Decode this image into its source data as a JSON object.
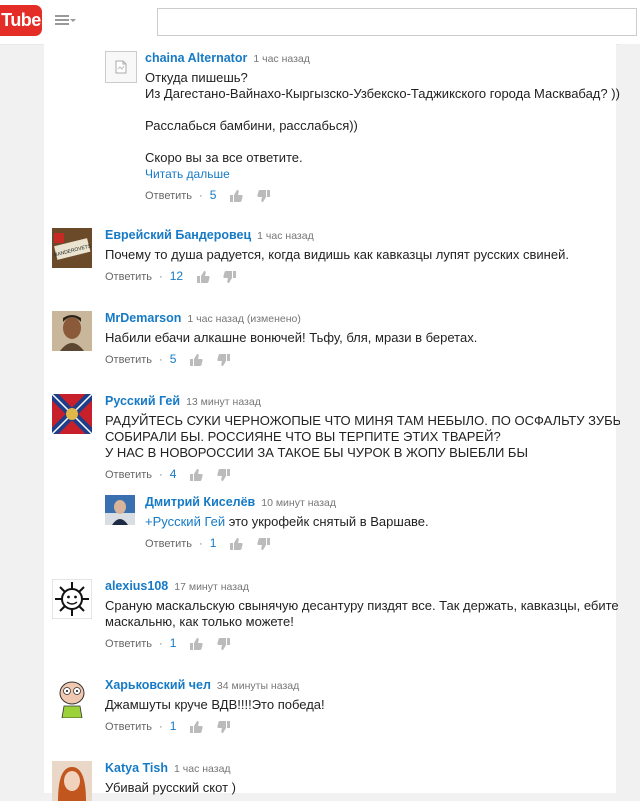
{
  "header": {
    "logo": "Tube",
    "search_placeholder": ""
  },
  "comments": [
    {
      "author": "chaina Alternator",
      "time": "1 час назад",
      "lines": [
        "Откуда пишешь?",
        "Из Дагестано-Вайнахо-Кыргызско-Узбекско-Таджикского города Масквабад? )))",
        "",
        "Расслабься бамбини, расслабься))",
        "",
        "Скоро вы за все ответите."
      ],
      "read_more": "Читать дальше",
      "reply": "Ответить",
      "sep": "·",
      "likes": "5"
    },
    {
      "author": "Еврейский Бандеровец",
      "time": "1 час назад",
      "lines": [
        "Почему то душа радуется, когда видишь как кавказцы лупят русских свиней."
      ],
      "reply": "Ответить",
      "sep": "·",
      "likes": "12",
      "avatar_text": "BANDEROVETS"
    },
    {
      "author": "MrDemarson",
      "time": "1 час назад (изменено)",
      "lines": [
        "Набили ебачи алкашне вонючей! Тьфу, бля, мрази в беретах."
      ],
      "reply": "Ответить",
      "sep": "·",
      "likes": "5"
    },
    {
      "author": "Русский Гей",
      "time": "13 минут назад",
      "lines": [
        "РАДУЙТЕСЬ СУКИ ЧЕРНОЖОПЫЕ ЧТО МИНЯ ТАМ НЕБЫЛО. ПО ОСФАЛЬТУ ЗУБЫ СВОИ",
        "СОБИРАЛИ БЫ. РОССИЯНЕ ЧТО ВЫ ТЕРПИТЕ ЭТИХ ТВАРЕЙ?",
        "У НАС В НОВОРОССИИ ЗА ТАКОЕ БЫ ЧУРОК В ЖОПУ ВЫЕБЛИ БЫ"
      ],
      "reply": "Ответить",
      "sep": "·",
      "likes": "4"
    },
    {
      "author": "Дмитрий Киселёв",
      "time": "10 минут назад",
      "mention": "+Русский Гей",
      "text_after": " это укрофейк снятый в Варшаве.",
      "reply": "Ответить",
      "sep": "·",
      "likes": "1"
    },
    {
      "author": "alexius108",
      "time": "17 минут назад",
      "lines": [
        "Сраную маскальскую свынячую десантуру пиздят все. Так держать, кавказцы, ебите",
        "маскальню, как только можете!"
      ],
      "reply": "Ответить",
      "sep": "·",
      "likes": "1"
    },
    {
      "author": "Харьковский чел",
      "time": "34 минуты назад",
      "lines": [
        "Джамшуты круче ВДВ!!!!Это победа!"
      ],
      "reply": "Ответить",
      "sep": "·",
      "likes": "1"
    },
    {
      "author": "Katya Tish",
      "time": "1 час назад",
      "lines": [
        "Убивай русский скот )"
      ]
    }
  ]
}
